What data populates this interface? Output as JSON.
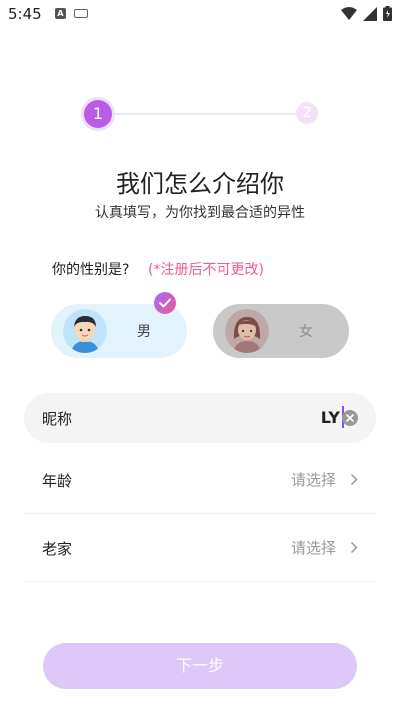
{
  "status_bar": {
    "time": "5:45",
    "notification_icon_letter": "A"
  },
  "stepper": {
    "step1": "1",
    "step2": "2"
  },
  "title": "我们怎么介绍你",
  "subtitle": "认真填写，为你找到最合适的异性",
  "gender": {
    "question": "你的性别是?",
    "note": "(*注册后不可更改)",
    "male_label": "男",
    "female_label": "女",
    "selected": "男"
  },
  "nickname": {
    "label": "昵称",
    "value": "LY"
  },
  "age": {
    "label": "年龄",
    "placeholder": "请选择"
  },
  "hometown": {
    "label": "老家",
    "placeholder": "请选择"
  },
  "next_button": {
    "label": "下一步"
  },
  "colors": {
    "accent": "#b95ce6",
    "note": "#f25a8f",
    "button": "#ddc8f7"
  }
}
